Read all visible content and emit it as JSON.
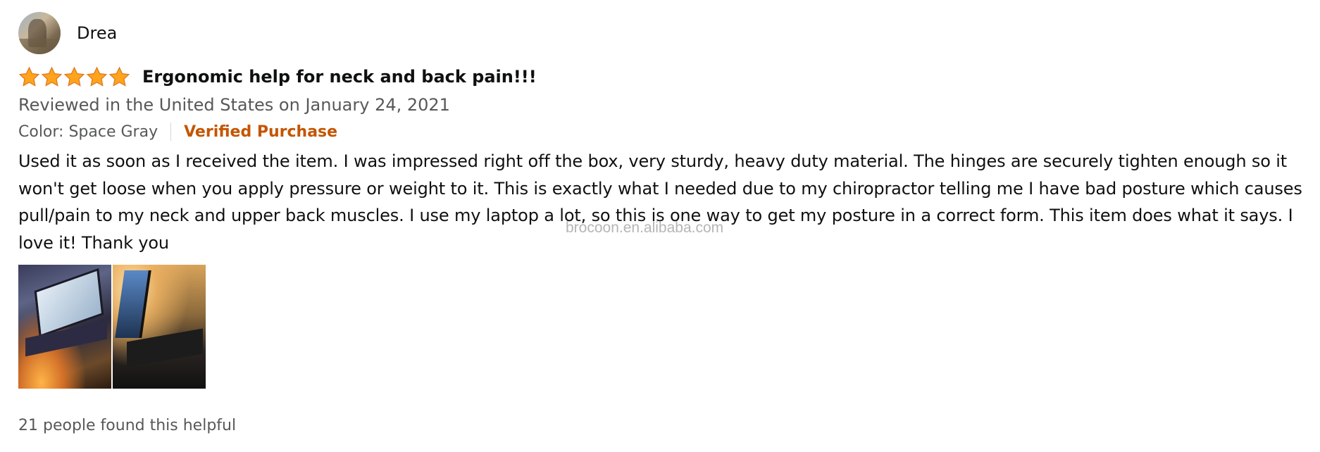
{
  "reviewer": {
    "name": "Drea",
    "avatar_icon": "profile-avatar"
  },
  "review": {
    "rating": 5,
    "rating_max": 5,
    "star_color": "#ffa41c",
    "title": "Ergonomic help for neck and back pain!!!",
    "date_line": "Reviewed in the United States on January 24, 2021",
    "variant": "Color: Space Gray",
    "verified_label": "Verified Purchase",
    "verified_color": "#c45500",
    "body": "Used it as soon as I received the item. I was impressed right off the box, very sturdy, heavy duty material. The hinges are securely tighten enough so it won't get loose when you apply pressure or weight to it. This is exactly what I needed due to my chiropractor telling me I have bad posture which causes pull/pain to my neck and upper back muscles. I use my laptop a lot, so this is one way to get my posture in a correct form. This item does what it says. I love it! Thank you",
    "images": [
      {
        "name": "review-image-1"
      },
      {
        "name": "review-image-2"
      }
    ],
    "helpful_text": "21 people found this helpful"
  },
  "watermark": "brocoon.en.alibaba.com"
}
